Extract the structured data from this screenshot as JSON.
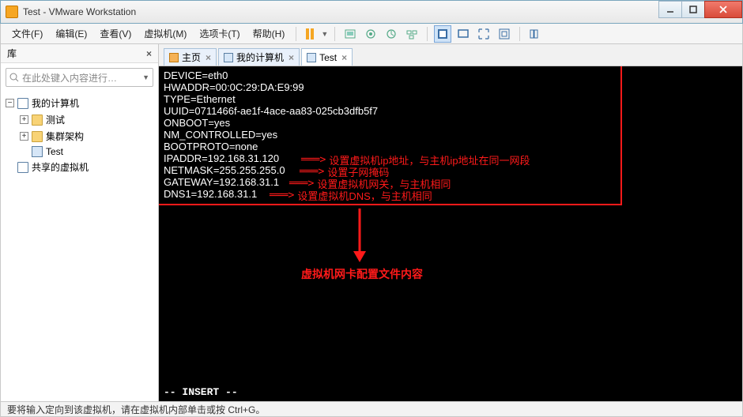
{
  "window": {
    "title": "Test - VMware Workstation"
  },
  "menu": {
    "file": "文件(F)",
    "edit": "编辑(E)",
    "view": "查看(V)",
    "vm": "虚拟机(M)",
    "tabs": "选项卡(T)",
    "help": "帮助(H)"
  },
  "sidebar": {
    "title": "库",
    "search_placeholder": "在此处键入内容进行…",
    "root": "我的计算机",
    "items": [
      "测试",
      "集群架构",
      "Test"
    ],
    "shared": "共享的虚拟机"
  },
  "tabs": {
    "home": "主页",
    "pc": "我的计算机",
    "test": "Test"
  },
  "terminal": {
    "lines": [
      "DEVICE=eth0",
      "HWADDR=00:0C:29:DA:E9:99",
      "TYPE=Ethernet",
      "UUID=0711466f-ae1f-4ace-aa83-025cb3dfb5f7",
      "ONBOOT=yes",
      "NM_CONTROLLED=yes",
      "BOOTPROTO=none",
      "IPADDR=192.168.31.120",
      "NETMASK=255.255.255.0",
      "GATEWAY=192.168.31.1",
      "DNS1=192.168.31.1"
    ],
    "mode": "-- INSERT --"
  },
  "annotations": {
    "ip": "设置虚拟机ip地址，与主机ip地址在同一网段",
    "netmask": "设置子网掩码",
    "gateway": "设置虚拟机网关，与主机相同",
    "dns": "设置虚拟机DNS，与主机相同",
    "summary": "虚拟机网卡配置文件内容"
  },
  "status": {
    "text": "要将输入定向到该虚拟机，请在虚拟机内部单击或按 Ctrl+G。"
  },
  "colors": {
    "accent_red": "#ff1a1a",
    "terminal_bg": "#000000",
    "terminal_fg": "#ffffff"
  }
}
